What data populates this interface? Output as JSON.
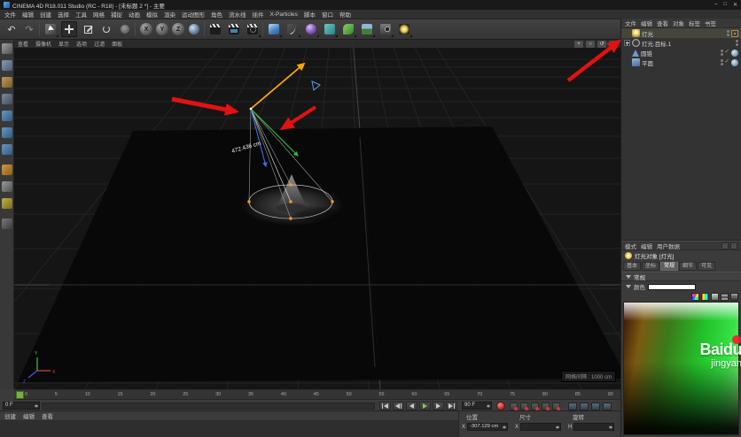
{
  "titlebar": {
    "title": "CINEMA 4D R18.011 Studio (RC - R18) - [未标题 2 *] - 主要",
    "minimize": "–",
    "maximize": "□",
    "close": "✕"
  },
  "menubar": {
    "items": [
      "文件",
      "编辑",
      "创建",
      "选择",
      "工具",
      "网格",
      "捕捉",
      "动画",
      "模拟",
      "渲染",
      "运动图形",
      "角色",
      "流水线",
      "插件",
      "X-Particles",
      "脚本",
      "窗口",
      "帮助"
    ]
  },
  "toolbar": {
    "x": "X",
    "y": "Y",
    "z": "Z"
  },
  "viewport": {
    "menus": [
      "查看",
      "摄像机",
      "显示",
      "选项",
      "过滤",
      "面板"
    ],
    "grid_label": "网格间隔 : 1000 cm",
    "distance_label": "472.436 cm",
    "axis_x": "X",
    "axis_y": "Y",
    "axis_z": "Z"
  },
  "timeline": {
    "ticks": [
      "0",
      "5",
      "10",
      "15",
      "20",
      "25",
      "30",
      "35",
      "40",
      "45",
      "50",
      "55",
      "60",
      "65",
      "70",
      "75",
      "80",
      "85",
      "90"
    ]
  },
  "transport": {
    "current_frame": "0 F",
    "end_frame": "90 F"
  },
  "object_manager": {
    "menus": [
      "文件",
      "编辑",
      "查看",
      "对象",
      "标签",
      "书签"
    ],
    "objects": [
      {
        "name": "灯光"
      },
      {
        "name": "灯光.目标.1"
      },
      {
        "name": "圆锥"
      },
      {
        "name": "平面"
      }
    ],
    "enabled_check": "✓"
  },
  "attribute_manager": {
    "menus": [
      "模式",
      "编辑",
      "用户数据"
    ],
    "title": "灯光对象 [灯光]",
    "tabs": [
      "基本",
      "坐标",
      "常规",
      "细节",
      "可见"
    ],
    "active_tab": "常规",
    "section": "常规",
    "color_label": "颜色",
    "color_value": "#FFFFFF"
  },
  "materials_panel": {
    "menus": [
      "创建",
      "编辑",
      "查看"
    ]
  },
  "coordinates_panel": {
    "groups": [
      {
        "header": "位置",
        "label": "X",
        "value": "-307.129 cm"
      },
      {
        "header": "尺寸",
        "label": "X",
        "value": ""
      },
      {
        "header": "旋转",
        "label": "H",
        "value": ""
      }
    ]
  },
  "watermark": {
    "line1": "Baidu",
    "line2": "jingyan"
  },
  "colors": {
    "accent_orange": "#ffaa00",
    "annotation_red": "#e01212",
    "play_green": "#7ecb4f",
    "spectrum_green": "#22c22a"
  }
}
